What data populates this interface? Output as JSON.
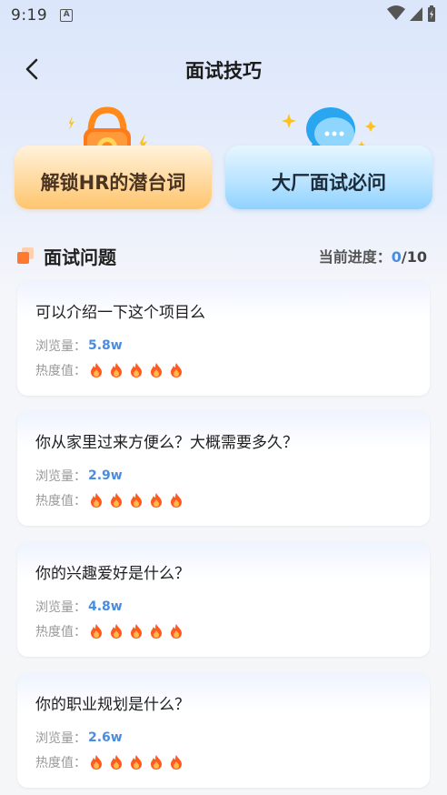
{
  "status_bar": {
    "time": "9:19",
    "notif_icon_letter": "A"
  },
  "header": {
    "title": "面试技巧"
  },
  "features": [
    {
      "label": "解锁HR的潜台词",
      "icon": "lock-icon"
    },
    {
      "label": "大厂面试必问",
      "icon": "chat-bubble-icon"
    }
  ],
  "section": {
    "title": "面试问题",
    "progress_label": "当前进度：",
    "progress_current": "0",
    "progress_total": "/10"
  },
  "labels": {
    "views": "浏览量：",
    "heat": "热度值："
  },
  "questions": [
    {
      "question": "可以介绍一下这个项目么",
      "views": "5.8w",
      "heat": 5
    },
    {
      "question": "你从家里过来方便么？大概需要多久？",
      "views": "2.9w",
      "heat": 5
    },
    {
      "question": "你的兴趣爱好是什么？",
      "views": "4.8w",
      "heat": 5
    },
    {
      "question": "你的职业规划是什么？",
      "views": "2.6w",
      "heat": 5
    }
  ],
  "colors": {
    "accent_blue": "#4a8de0",
    "section_orange": "#ff7a2e"
  }
}
